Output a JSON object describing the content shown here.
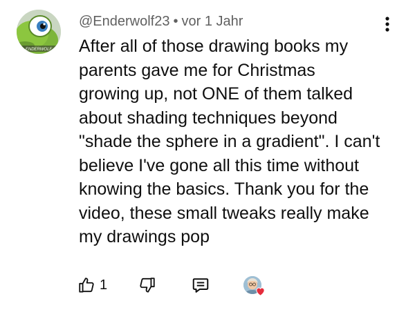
{
  "comment": {
    "author": "@Enderwolf23",
    "separator": "•",
    "timestamp": "vor 1 Jahr",
    "avatar_badge_text": "ENDERWOLF",
    "text_lines": [
      "After all of those drawing books my",
      "parents gave me for Christmas",
      "growing up, not ONE of them talked",
      "about shading techniques beyond",
      "\"shade the sphere in a gradient\". I can't",
      "believe I've gone all this time without",
      "knowing the basics. Thank you for the",
      "video, these small tweaks really make",
      "my drawings pop"
    ],
    "like_count": "1"
  },
  "icons": {
    "menu": "more-vert-icon",
    "like": "thumb-up-icon",
    "dislike": "thumb-down-icon",
    "reply": "reply-comment-icon",
    "creator_heart": "creator-heart-icon"
  },
  "colors": {
    "text": "#0f0f0f",
    "secondary_text": "#606060",
    "heart": "#e52d3c",
    "background": "#ffffff"
  }
}
